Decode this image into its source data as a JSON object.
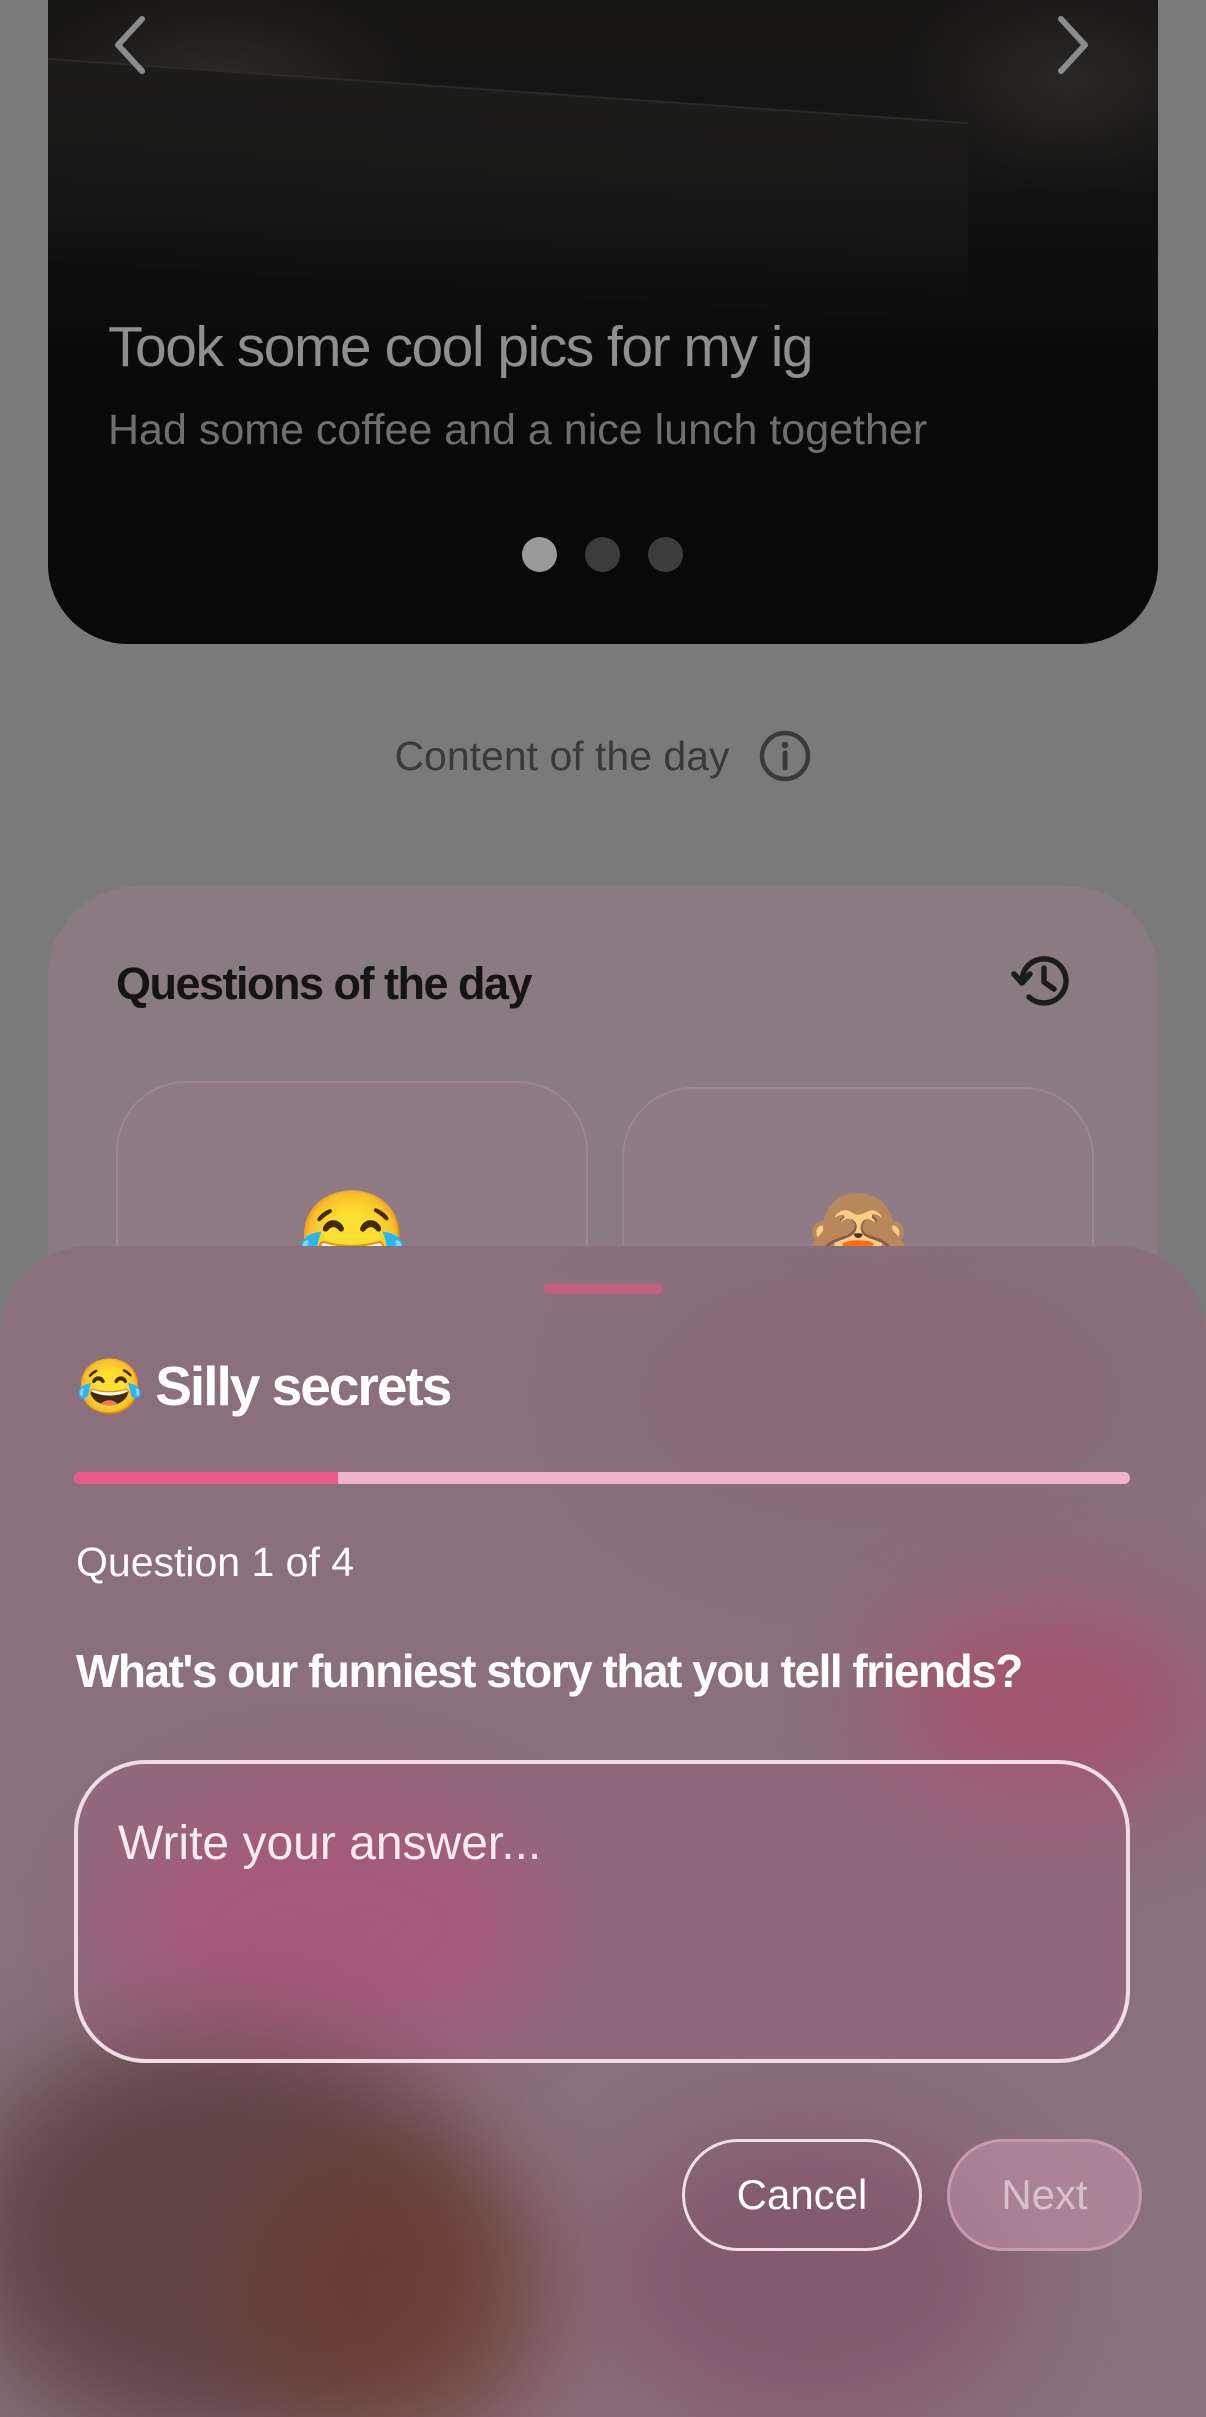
{
  "hero": {
    "title": "Took some cool pics for my ig",
    "subtitle": "Had some coffee and a nice lunch together",
    "slide_count": 3,
    "active_slide": 0
  },
  "content_of_day": {
    "label": "Content of the day",
    "icon": "info-icon"
  },
  "questions_card": {
    "title": "Questions of the day",
    "history_icon": "history-icon",
    "items": [
      {
        "emoji": "😂"
      },
      {
        "emoji": "🙈"
      }
    ]
  },
  "sheet": {
    "title_emoji": "😂",
    "title": "Silly secrets",
    "progress_fraction": 0.25,
    "question_counter": "Question 1 of 4",
    "question": "What's our funniest story that you tell friends?",
    "answer_placeholder": "Write your answer...",
    "answer_value": "",
    "cancel_label": "Cancel",
    "next_label": "Next"
  },
  "colors": {
    "accent_pink": "#e95a8a",
    "progress_track": "#f0b3c9",
    "sheet_bg": "#8a6f7c"
  }
}
